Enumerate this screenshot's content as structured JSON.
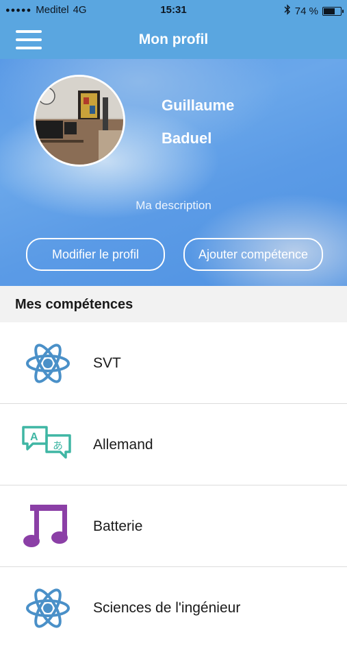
{
  "status_bar": {
    "carrier": "Meditel",
    "network": "4G",
    "time": "15:31",
    "battery_percent_text": "74 %",
    "battery_level": 0.74
  },
  "navbar": {
    "title": "Mon profil",
    "menu_icon": "hamburger-icon",
    "bg_color": "#5aa6e0"
  },
  "profile": {
    "first_name": "Guillaume",
    "last_name": "Baduel",
    "description": "Ma description",
    "edit_button": "Modifier le profil",
    "add_skill_button": "Ajouter compétence"
  },
  "skills_section": {
    "title": "Mes compétences",
    "items": [
      {
        "label": "SVT",
        "icon": "atom-icon",
        "color": "#4a90c8"
      },
      {
        "label": "Allemand",
        "icon": "translate-icon",
        "color": "#3fb6a4"
      },
      {
        "label": "Batterie",
        "icon": "music-note-icon",
        "color": "#8b3fa6"
      },
      {
        "label": "Sciences de l'ingénieur",
        "icon": "atom-icon",
        "color": "#4a90c8"
      }
    ]
  }
}
